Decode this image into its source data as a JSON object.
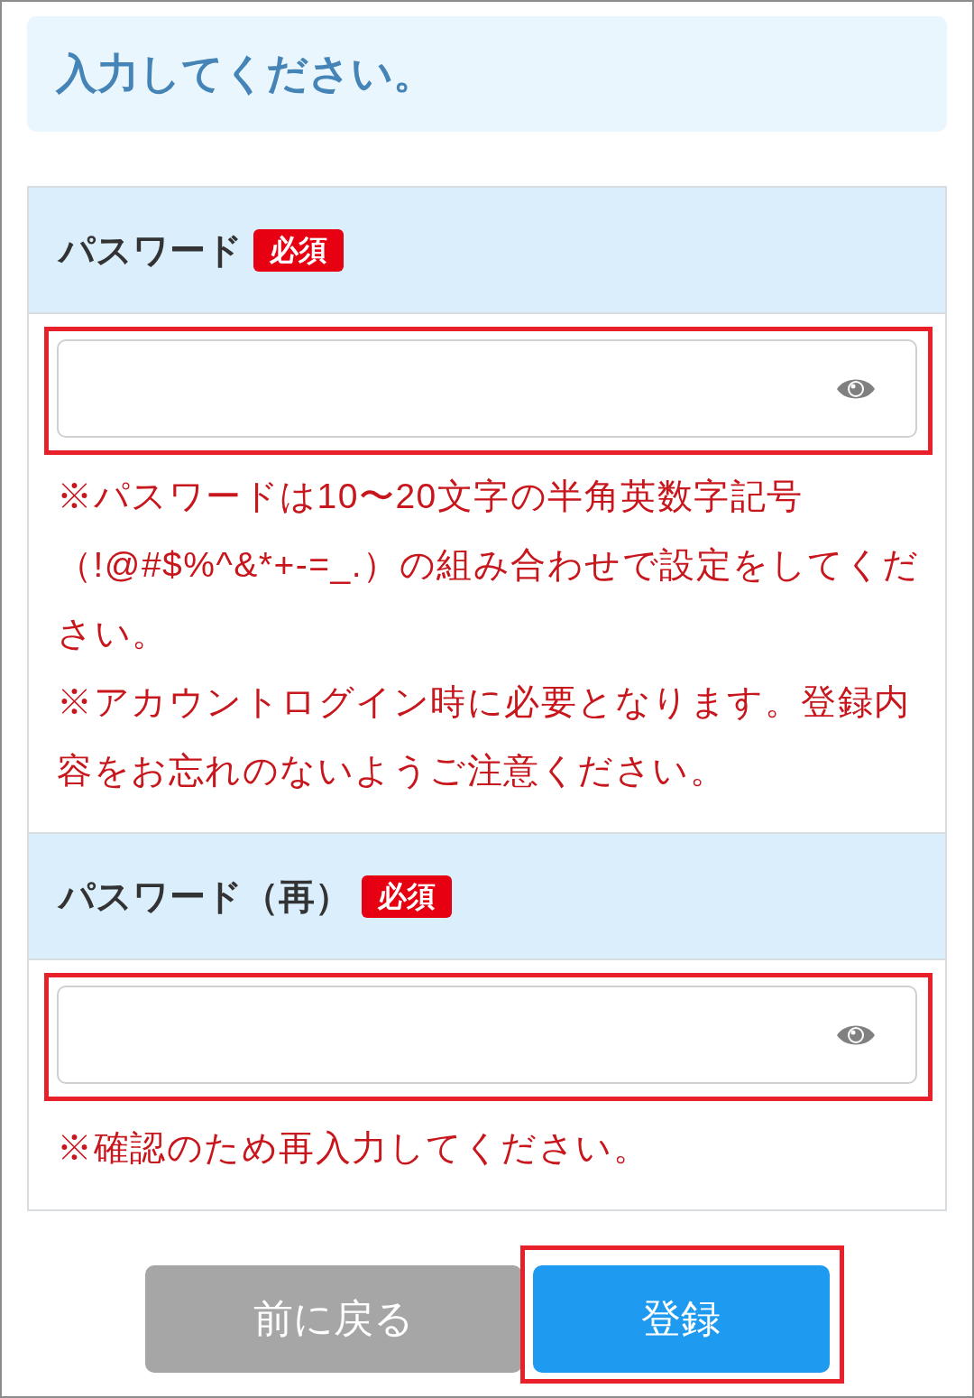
{
  "header": {
    "title": "入力してください。"
  },
  "sections": [
    {
      "label": "パスワード",
      "badge": "必須",
      "field": {
        "highlighted": true
      },
      "notes": [
        "※パスワードは10〜20文字の半角英数字記号（!@#$%^&*+-=_.）の組み合わせで設定をしてください。",
        "※アカウントログイン時に必要となります。登録内容をお忘れのないようご注意ください。"
      ]
    },
    {
      "label": "パスワード（再）",
      "badge": "必須",
      "field": {
        "highlighted": true
      },
      "notes": [
        "※確認のため再入力してください。"
      ]
    }
  ],
  "buttons": [
    {
      "label": "前に戻る",
      "kind": "secondary",
      "highlighted": false
    },
    {
      "label": "登録",
      "kind": "primary",
      "highlighted": true
    }
  ]
}
